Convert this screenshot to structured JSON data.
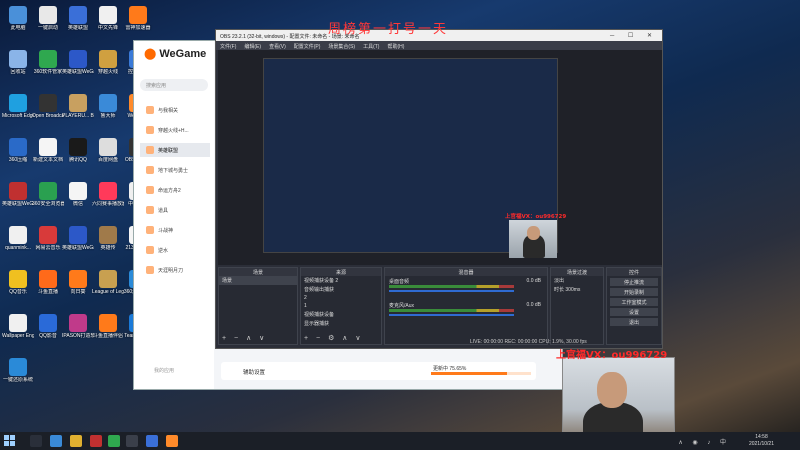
{
  "desktop": {
    "icons": [
      {
        "label": "此电脑",
        "color": "#4a90d9"
      },
      {
        "label": "一键启动",
        "color": "#e8e8e8"
      },
      {
        "label": "英雄联盟",
        "color": "#3a6fd8"
      },
      {
        "label": "中文先锋",
        "color": "#f0f0f0"
      },
      {
        "label": "雷神加速器",
        "color": "#ff7a1a"
      },
      {
        "label": "回收站",
        "color": "#8ab4e8"
      },
      {
        "label": "360软件管家",
        "color": "#2fa84f"
      },
      {
        "label": "英雄联盟WeGame版",
        "color": "#2c58c8"
      },
      {
        "label": "穿越火线",
        "color": "#d0a040"
      },
      {
        "label": "控制面板",
        "color": "#3a7ad8"
      },
      {
        "label": "Microsoft Edge",
        "color": "#1fa0e0"
      },
      {
        "label": "Open Broadcast...",
        "color": "#333"
      },
      {
        "label": "PLAYERU... BATTLEGR...",
        "color": "#c8a060"
      },
      {
        "label": "鲁大师",
        "color": "#3a8ad8"
      },
      {
        "label": "WeGame",
        "color": "#ff8a2a"
      },
      {
        "label": "360压缩",
        "color": "#2a6ac8"
      },
      {
        "label": "新建文本文档",
        "color": "#f5f5f5"
      },
      {
        "label": "腾讯QQ",
        "color": "#1a1a1a"
      },
      {
        "label": "百度网盘",
        "color": "#ddd"
      },
      {
        "label": "OBS Studio",
        "color": "#333"
      },
      {
        "label": "英雄联盟WeGame版",
        "color": "#c03030"
      },
      {
        "label": "360安全浏览器",
        "color": "#2aa050"
      },
      {
        "label": "微信",
        "color": "#f5f5f5"
      },
      {
        "label": "六同赛事播放器",
        "color": "#ff3a5a"
      },
      {
        "label": "中文先锋",
        "color": "#f0f0f0"
      },
      {
        "label": "quanmink...",
        "color": "#f0f0f0"
      },
      {
        "label": "网易云音乐",
        "color": "#d83a3a"
      },
      {
        "label": "英雄联盟WeGame版",
        "color": "#2c58c8"
      },
      {
        "label": "英雄传",
        "color": "#a07a4a"
      },
      {
        "label": "213123131",
        "color": "#f5f5f5"
      },
      {
        "label": "QQ音乐",
        "color": "#f0c020"
      },
      {
        "label": "斗鱼直播",
        "color": "#ff6a1a"
      },
      {
        "label": "向日葵",
        "color": "#ff7a1a"
      },
      {
        "label": "League of Legends",
        "color": "#c8a050"
      },
      {
        "label": "360游戏大厅",
        "color": "#2a8ad8"
      },
      {
        "label": "Wallpaper Engine",
        "color": "#f0f0f0"
      },
      {
        "label": "QQ影音",
        "color": "#2a6ad8"
      },
      {
        "label": "IPASON打造软件",
        "color": "#c03a8a"
      },
      {
        "label": "斗鱼直播伴侣",
        "color": "#ff7a1a"
      },
      {
        "label": "TeamViewer",
        "color": "#1a7ad8"
      },
      {
        "label": "一键还原系统",
        "color": "#2a8ad8"
      }
    ]
  },
  "wegame": {
    "logo": "WeGame",
    "search_placeholder": "搜索应用",
    "nav": [
      {
        "label": "与我相关"
      },
      {
        "label": "穿越火线+H..."
      },
      {
        "label": "英雄联盟",
        "active": true
      },
      {
        "label": "地下城与勇士"
      },
      {
        "label": "命运方舟2"
      },
      {
        "label": "道具"
      },
      {
        "label": "斗战神"
      },
      {
        "label": "逆水"
      },
      {
        "label": "天涯明月刀"
      }
    ],
    "footer": "我的应用",
    "helper_label": "辅助设置",
    "download_label": "更新中 75.65%",
    "download_progress": 75.65
  },
  "obs": {
    "title": "OBS 23.2.1 (32-bit, windows) - 配置文件: 未命名 - 场景: 未命名",
    "menu": [
      "文件(F)",
      "编辑(E)",
      "查看(V)",
      "配置文件(P)",
      "场景集合(S)",
      "工具(T)",
      "帮助(H)"
    ],
    "docks": {
      "scenes": {
        "header": "场景",
        "items": [
          "场景"
        ]
      },
      "sources": {
        "header": "来源",
        "items": [
          "视频捕获设备 2",
          "音频输出捕获",
          "2",
          "1",
          "视频捕获设备",
          "显示器捕获"
        ]
      },
      "mixer": {
        "header": "混音器",
        "channels": [
          {
            "name": "桌面音频",
            "db": "0.0 dB"
          },
          {
            "name": "麦克风/Aux",
            "db": "0.0 dB"
          }
        ]
      },
      "transitions": {
        "header": "场景过渡",
        "type": "淡出",
        "duration_label": "时长",
        "duration": "300ms"
      },
      "controls": {
        "header": "控件",
        "buttons": [
          "停止推流",
          "开始录制",
          "工作室模式",
          "设置",
          "退出"
        ]
      }
    },
    "status": "LIVE: 00:00:00   REC: 00:00:00   CPU: 1.9%, 30.00 fps"
  },
  "overlay": {
    "title": "周榜第一打号一天",
    "wx_main": "上官福VX：ou996729",
    "wx_small": "上官福VX：ou996729"
  },
  "taskbar": {
    "time": "14:58",
    "date": "2021/10/21"
  }
}
